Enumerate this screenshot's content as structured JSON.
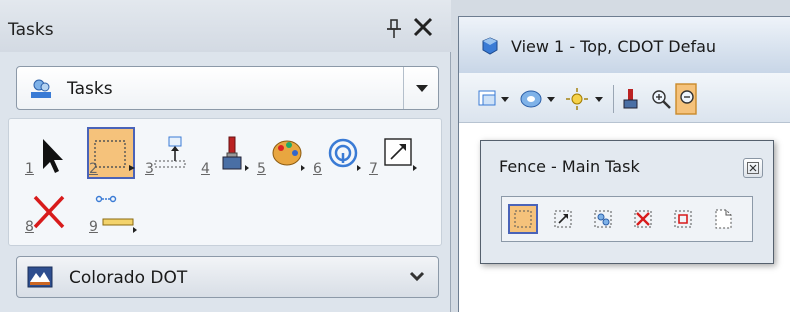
{
  "tasks_panel": {
    "title": "Tasks",
    "dropdown": {
      "label": "Tasks",
      "icon": "tasks-icon"
    },
    "tools": [
      {
        "num": "1",
        "name": "select-element",
        "icon": "arrow-icon"
      },
      {
        "num": "2",
        "name": "place-fence",
        "icon": "fence-icon",
        "selected": true
      },
      {
        "num": "3",
        "name": "modify-fence",
        "icon": "modify-fence-icon"
      },
      {
        "num": "4",
        "name": "level-display",
        "icon": "brush-icon"
      },
      {
        "num": "5",
        "name": "element-attributes",
        "icon": "palette-icon"
      },
      {
        "num": "6",
        "name": "search",
        "icon": "target-icon"
      },
      {
        "num": "7",
        "name": "scale",
        "icon": "scale-icon"
      },
      {
        "num": "8",
        "name": "delete",
        "icon": "delete-icon"
      },
      {
        "num": "9",
        "name": "measure",
        "icon": "measure-icon"
      }
    ],
    "workflow": {
      "label": "Colorado DOT",
      "icon": "colorado-dot-icon"
    }
  },
  "view_window": {
    "title": "View 1 - Top, CDOT Defau"
  },
  "fence_dialog": {
    "title": "Fence - Main Task",
    "tools": [
      "place-fence",
      "modify-fence",
      "manipulate-fence",
      "delete-fence",
      "fence-stretch",
      "fence-file"
    ]
  },
  "colors": {
    "selected_fill": "#f5c27b",
    "selected_border": "#4a63b8",
    "delete_red": "#d81b1b",
    "panel_bg": "#dde4ec"
  }
}
